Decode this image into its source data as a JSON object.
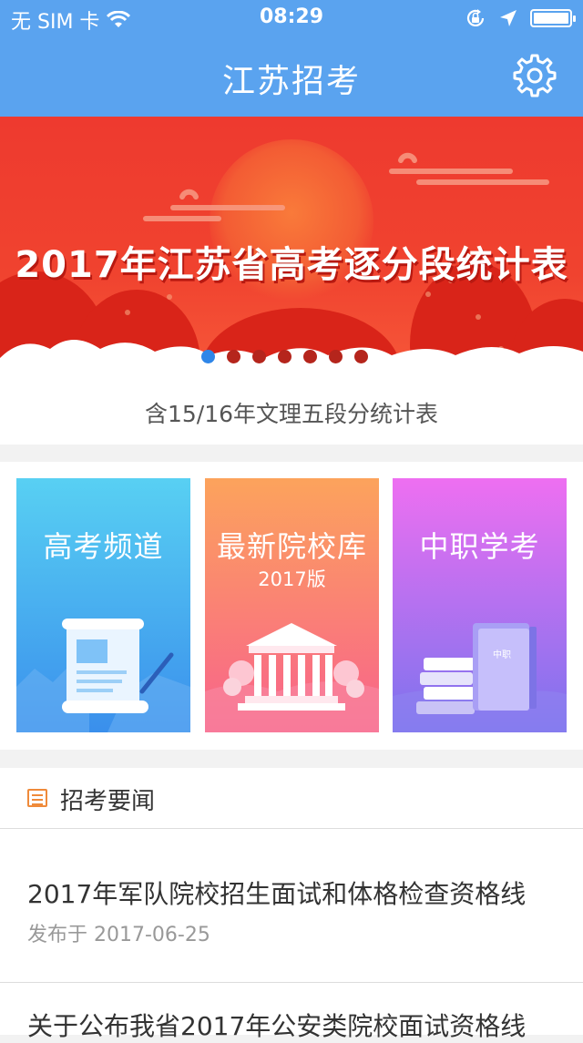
{
  "status_bar": {
    "carrier": "无 SIM 卡",
    "time": "08:29",
    "icons": [
      "wifi-icon",
      "rotation-lock-icon",
      "location-arrow-icon",
      "battery-icon"
    ]
  },
  "nav": {
    "title": "江苏招考",
    "settings_icon": "gear-icon"
  },
  "banner": {
    "title": "2017年江苏省高考逐分段统计表",
    "caption": "含15/16年文理五段分统计表",
    "page_count": 7,
    "active_index": 0
  },
  "tiles": [
    {
      "title": "高考频道",
      "subtitle": ""
    },
    {
      "title": "最新院校库",
      "subtitle": "2017版"
    },
    {
      "title": "中职学考",
      "subtitle": "",
      "book_label": "中职"
    }
  ],
  "news": {
    "header": "招考要闻",
    "items": [
      {
        "title": "2017年军队院校招生面试和体格检查资格线",
        "date": "发布于 2017-06-25"
      },
      {
        "title": "关于公布我省2017年公安类院校面试资格线",
        "date": ""
      }
    ]
  },
  "colors": {
    "nav_bg": "#5aa3ef",
    "banner_red": "#f0432f",
    "dot_active": "#2f86e8",
    "news_icon": "#ef8a3a"
  }
}
